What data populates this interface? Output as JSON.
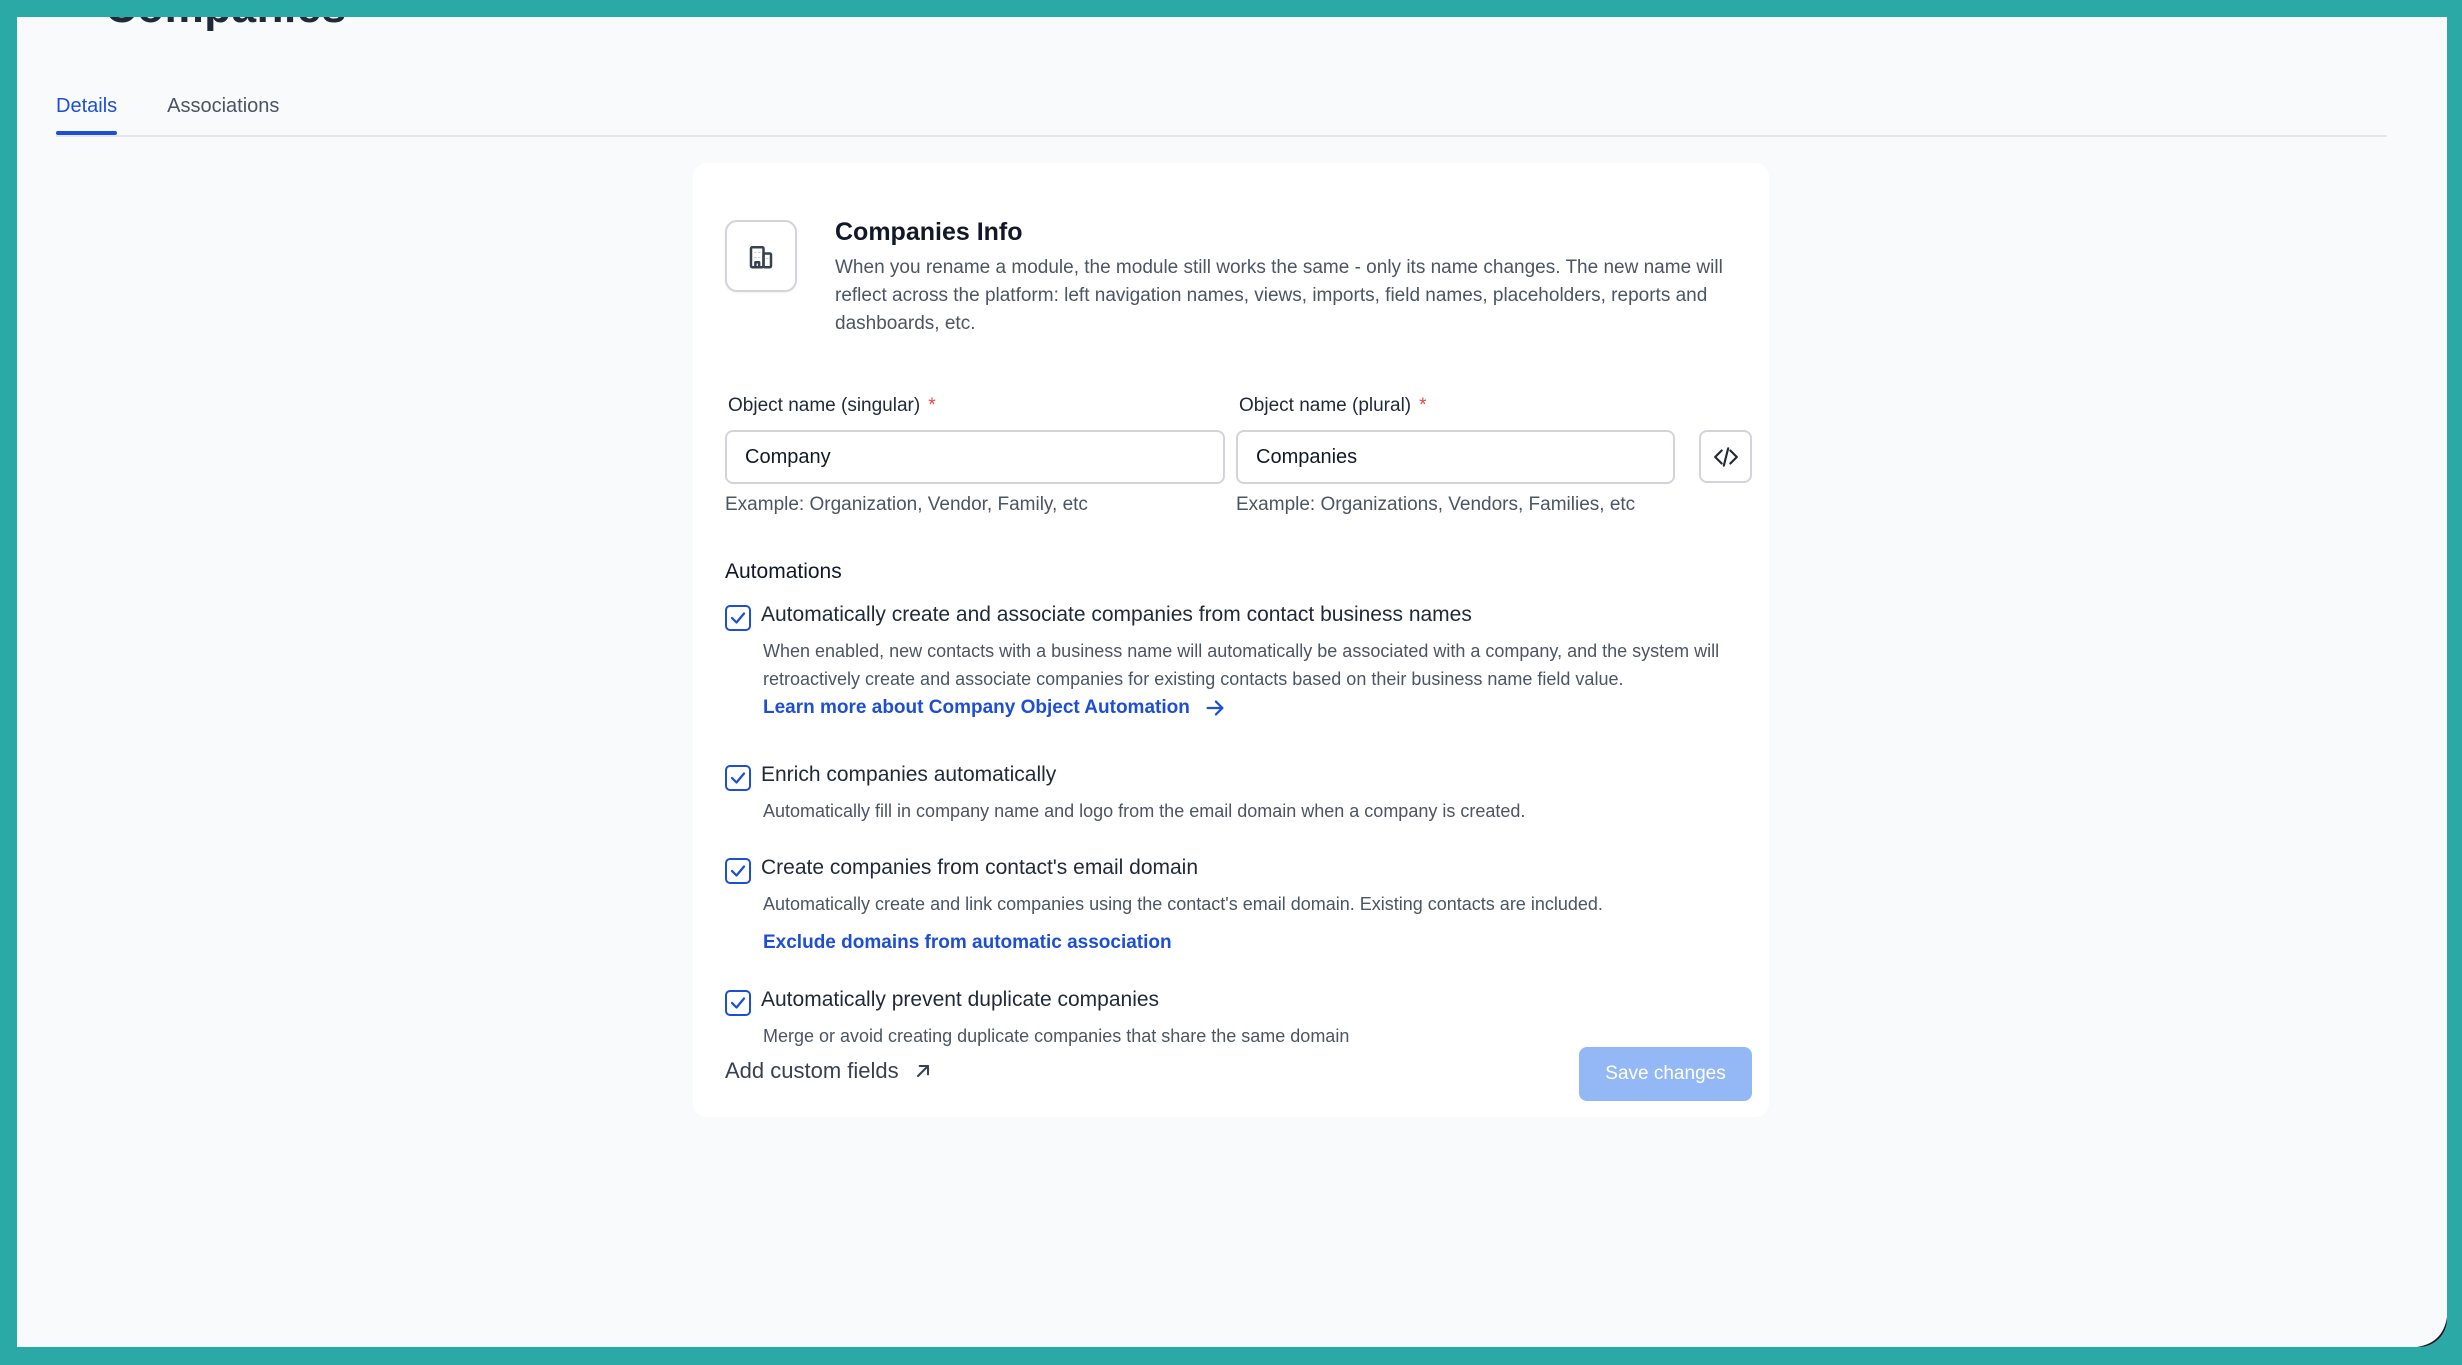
{
  "page": {
    "title_cutoff": "Companies"
  },
  "tabs": [
    {
      "label": "Details",
      "active": true
    },
    {
      "label": "Associations",
      "active": false
    }
  ],
  "info": {
    "icon": "building-icon",
    "title": "Companies Info",
    "description": "When you rename a module, the module still works the same - only its name changes. The new name will reflect across the platform: left navigation names, views, imports, field names, placeholders, reports and dashboards, etc."
  },
  "fields": {
    "singular": {
      "label": "Object name (singular)",
      "required_mark": "*",
      "value": "Company",
      "hint": "Example: Organization, Vendor, Family, etc"
    },
    "plural": {
      "label": "Object name (plural)",
      "required_mark": "*",
      "value": "Companies",
      "hint": "Example: Organizations, Vendors, Families, etc"
    },
    "code_button_icon": "code-icon"
  },
  "automations": {
    "title": "Automations",
    "items": [
      {
        "label": "Automatically create and associate companies from contact business names",
        "checked": true,
        "description": "When enabled, new contacts with a business name will automatically be associated with a company, and the system will retroactively create and associate companies for existing contacts based on their business name field value.",
        "link": "Learn more about Company Object Automation"
      },
      {
        "label": "Enrich companies automatically",
        "checked": true,
        "description": "Automatically fill in company name and logo from the email domain when a company is created."
      },
      {
        "label": "Create companies from contact's email domain",
        "checked": true,
        "description": "Automatically create and link companies using the contact's email domain. Existing contacts are included.",
        "link": "Exclude domains from automatic association"
      },
      {
        "label": "Automatically prevent duplicate companies",
        "checked": true,
        "description": "Merge or avoid creating duplicate companies that share the same domain"
      }
    ]
  },
  "footer": {
    "add_custom_fields": "Add custom fields",
    "save_button": "Save changes"
  },
  "colors": {
    "accent": "#1d4ed8",
    "save_disabled": "#93b8f5",
    "frame": "#2aa9a6",
    "required": "#ef4444"
  }
}
